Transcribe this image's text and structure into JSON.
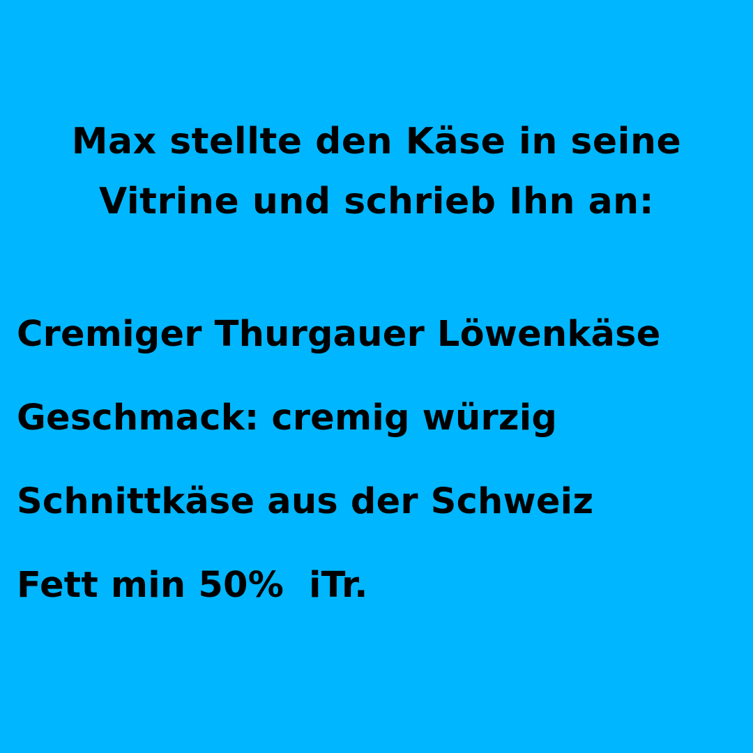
{
  "background_color": "#00b6fe",
  "text_color": "#000000",
  "headline": {
    "line1": "Max stellte den Käse in seine",
    "line2": "Vitrine und schrieb Ihn an:"
  },
  "details": [
    "Cremiger Thurgauer Löwenkäse",
    "Geschmack: cremig würzig",
    "Schnittkäse aus der Schweiz",
    "Fett min 50%  iTr."
  ]
}
